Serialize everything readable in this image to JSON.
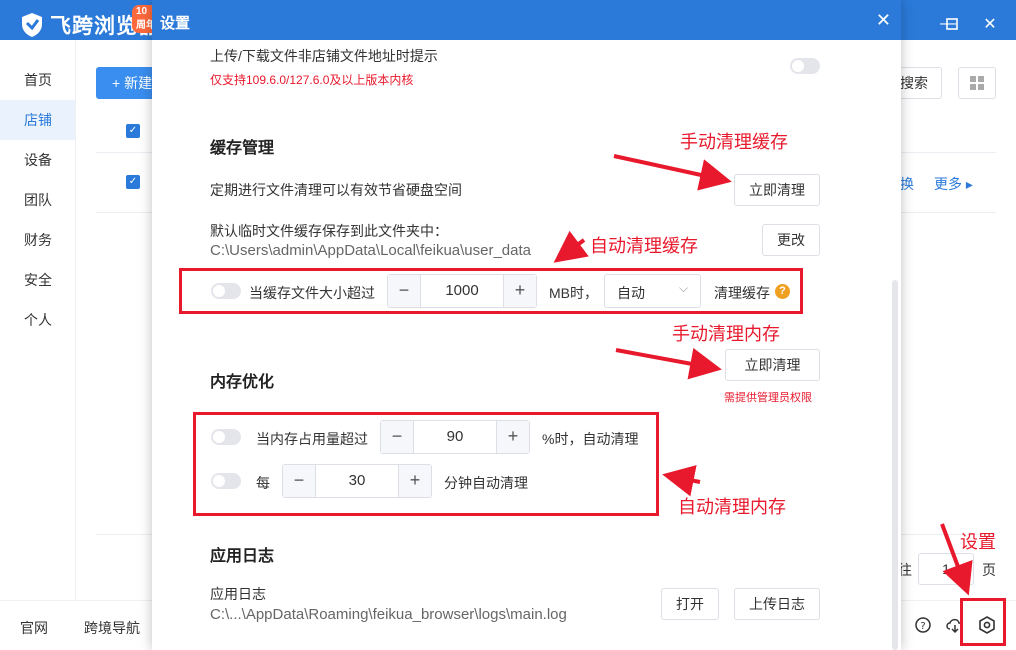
{
  "app": {
    "logo_text": "飞跨浏览器",
    "logo_badge": "10周年"
  },
  "sidebar": {
    "items": [
      {
        "label": "首页"
      },
      {
        "label": "店铺"
      },
      {
        "label": "设备"
      },
      {
        "label": "团队"
      },
      {
        "label": "财务"
      },
      {
        "label": "安全"
      },
      {
        "label": "个人"
      }
    ]
  },
  "main": {
    "new_button": "+ 新建",
    "search_button": "搜索",
    "more_link": "更多 ▸",
    "blue_fragment": "换",
    "pager": {
      "prefix": "往",
      "page": "1",
      "suffix": "页"
    }
  },
  "footer": {
    "links": [
      "官网",
      "跨境导航"
    ]
  },
  "dialog": {
    "title": "设置",
    "upload_section": {
      "label": "上传/下载文件非店铺文件地址时提示",
      "note": "仅支持109.6.0/127.6.0及以上版本内核"
    },
    "cache": {
      "heading": "缓存管理",
      "desc": "定期进行文件清理可以有效节省硬盘空间",
      "clean_now": "立即清理",
      "path_label": "默认临时文件缓存保存到此文件夹中：",
      "path_value": "C:\\Users\\admin\\AppData\\Local\\feikua\\user_data",
      "change_button": "更改",
      "auto_label": "当缓存文件大小超过",
      "size_value": "1000",
      "unit": "MB时，",
      "mode_select": "自动",
      "clean_label": "清理缓存"
    },
    "memory": {
      "heading": "内存优化",
      "clean_now": "立即清理",
      "admin_note": "需提供管理员权限",
      "usage_label": "当内存占用量超过",
      "usage_value": "90",
      "usage_suffix": "%时，自动清理",
      "interval_prefix": "每",
      "interval_value": "30",
      "interval_suffix": "分钟自动清理"
    },
    "logs": {
      "heading": "应用日志",
      "label": "应用日志",
      "path_value": "C:\\...\\AppData\\Roaming\\feikua_browser\\logs\\main.log",
      "open_button": "打开",
      "upload_button": "上传日志"
    }
  },
  "annotations": {
    "manual_cache": "手动清理缓存",
    "auto_cache": "自动清理缓存",
    "manual_memory": "手动清理内存",
    "auto_memory": "自动清理内存",
    "settings": "设置"
  },
  "colors": {
    "brand_blue": "#2b7ad9",
    "annotation_red": "#e8192c",
    "warning_orange": "#f0a020"
  }
}
